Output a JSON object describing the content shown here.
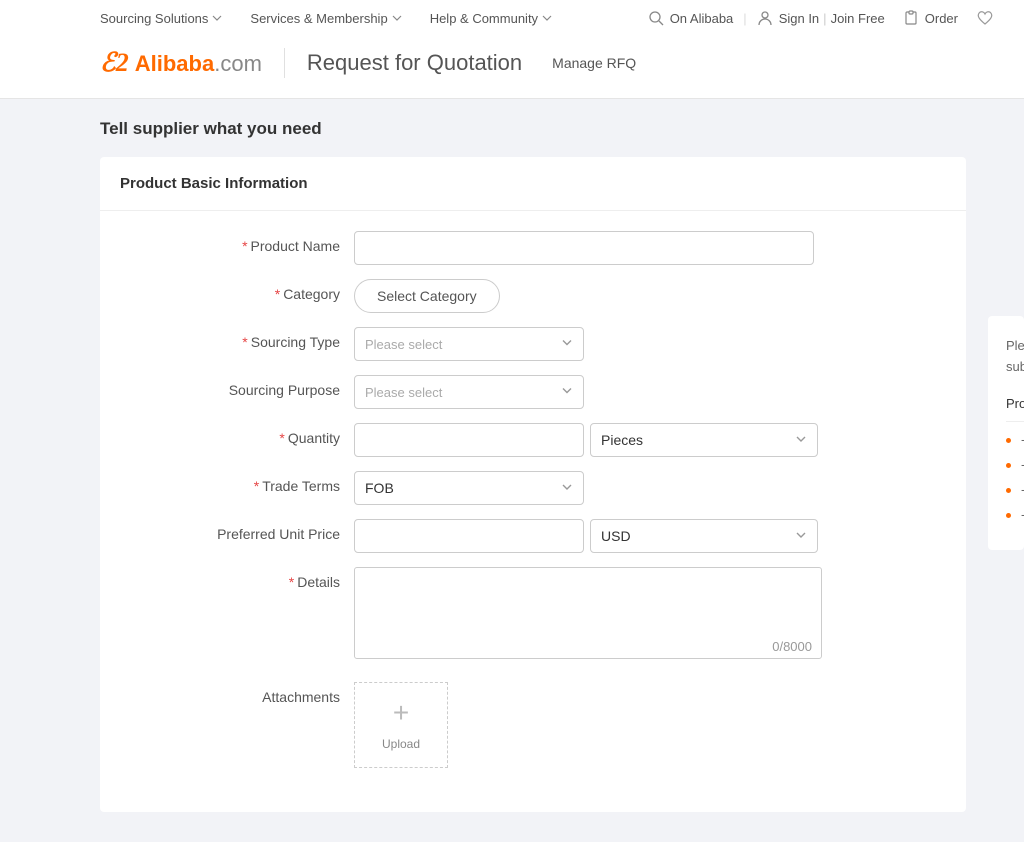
{
  "topnav": {
    "items": [
      "Sourcing Solutions",
      "Services & Membership",
      "Help & Community"
    ]
  },
  "topright": {
    "on_alibaba": "On Alibaba",
    "sign_in": "Sign In",
    "join_free": "Join Free",
    "order": "Order"
  },
  "logo": {
    "mark": "ℰ2",
    "name": "Alibaba",
    "suffix": ".com"
  },
  "header": {
    "page_title": "Request for Quotation",
    "manage_link": "Manage RFQ"
  },
  "main": {
    "section_heading": "Tell supplier what you need",
    "card_title": "Product Basic Information",
    "labels": {
      "product_name": "Product Name",
      "category": "Category",
      "sourcing_type": "Sourcing Type",
      "sourcing_purpose": "Sourcing Purpose",
      "quantity": "Quantity",
      "trade_terms": "Trade Terms",
      "preferred_unit_price": "Preferred Unit Price",
      "details": "Details",
      "attachments": "Attachments"
    },
    "placeholders": {
      "please_select": "Please select"
    },
    "buttons": {
      "select_category": "Select Category",
      "upload": "Upload"
    },
    "values": {
      "product_name": "",
      "sourcing_type": "",
      "sourcing_purpose": "",
      "quantity": "",
      "quantity_unit": "Pieces",
      "trade_terms": "FOB",
      "preferred_unit_price": "",
      "currency": "USD",
      "details": ""
    },
    "char_count": "0/8000"
  },
  "sidebar": {
    "intro_line1": "Plea",
    "intro_line2": "sub",
    "heading": "Produ",
    "items": [
      "- P",
      "- S",
      "- Q",
      "- D"
    ]
  }
}
